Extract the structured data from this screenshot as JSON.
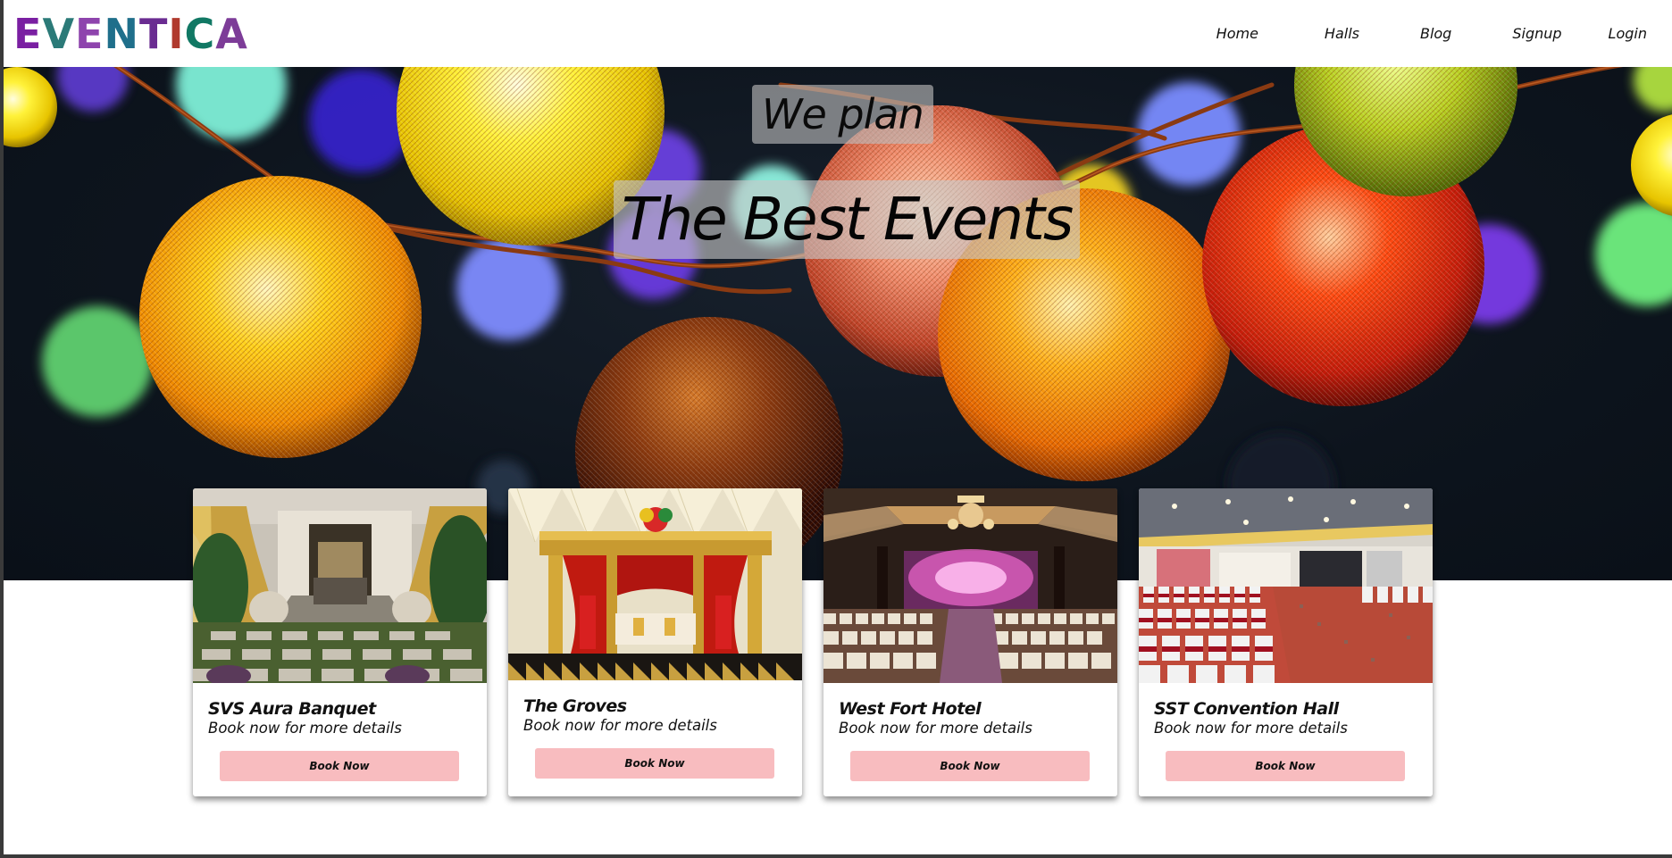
{
  "brand": {
    "logo_letters": [
      {
        "ch": "E",
        "color": "#7a1fa2"
      },
      {
        "ch": "V",
        "color": "#2b7a78"
      },
      {
        "ch": "E",
        "color": "#8e44ad"
      },
      {
        "ch": "N",
        "color": "#1f6f8b"
      },
      {
        "ch": "T",
        "color": "#6a2c91"
      },
      {
        "ch": "I",
        "color": "#b03a2e"
      },
      {
        "ch": "C",
        "color": "#117864"
      },
      {
        "ch": "A",
        "color": "#7d3c98"
      }
    ],
    "logo_text": "EVENTICA"
  },
  "nav": {
    "home": "Home",
    "halls": "Halls",
    "blog": "Blog",
    "signup": "Signup",
    "login": "Login"
  },
  "hero": {
    "line1": "We plan",
    "line2": "The Best Events"
  },
  "cards": [
    {
      "title": "SVS Aura Banquet",
      "subtitle": "Book now for more details",
      "button": "Book Now"
    },
    {
      "title": "The Groves",
      "subtitle": "Book now for more details",
      "button": "Book Now"
    },
    {
      "title": "West Fort Hotel",
      "subtitle": "Book now for more details",
      "button": "Book Now"
    },
    {
      "title": "SST Convention Hall",
      "subtitle": "Book now for more details",
      "button": "Book Now"
    }
  ],
  "colors": {
    "button_bg": "#f8bcbf",
    "page_bg": "#ffffff",
    "hero_bg": "#0d141d"
  }
}
